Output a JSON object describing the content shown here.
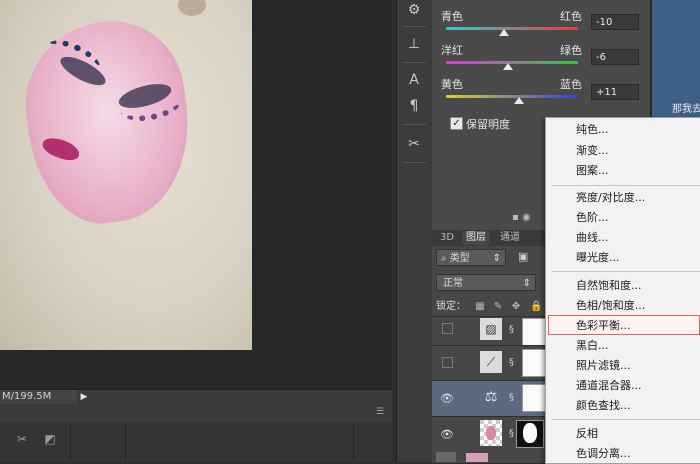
{
  "canvas": {
    "doc_size": "M/199.5M"
  },
  "properties": {
    "sliders": [
      {
        "left": "青色",
        "right": "红色",
        "value": "-10",
        "fraction": 0.44,
        "gradient": [
          "#38c7d6",
          "#e04040"
        ]
      },
      {
        "left": "洋红",
        "right": "绿色",
        "value": "-6",
        "fraction": 0.47,
        "gradient": [
          "#d63fd0",
          "#39c24a"
        ]
      },
      {
        "left": "黄色",
        "right": "蓝色",
        "value": "+11",
        "fraction": 0.55,
        "gradient": [
          "#e0d030",
          "#3040e0"
        ]
      }
    ],
    "preserve_luminosity": "保留明度"
  },
  "right_strip_text": "那我去",
  "layers": {
    "tabs": [
      "3D",
      "图层",
      "通道"
    ],
    "filter": "类型",
    "blend_mode": "正常",
    "lock_label": "锁定："
  },
  "context_menu": {
    "items": [
      "纯色...",
      "渐变...",
      "图案...",
      "亮度/对比度...",
      "色阶...",
      "曲线...",
      "曝光度...",
      "自然饱和度...",
      "色相/饱和度...",
      "色彩平衡...",
      "黑白...",
      "照片滤镜...",
      "通道混合器...",
      "颜色查找...",
      "反相",
      "色调分离..."
    ],
    "highlighted": "色彩平衡..."
  }
}
